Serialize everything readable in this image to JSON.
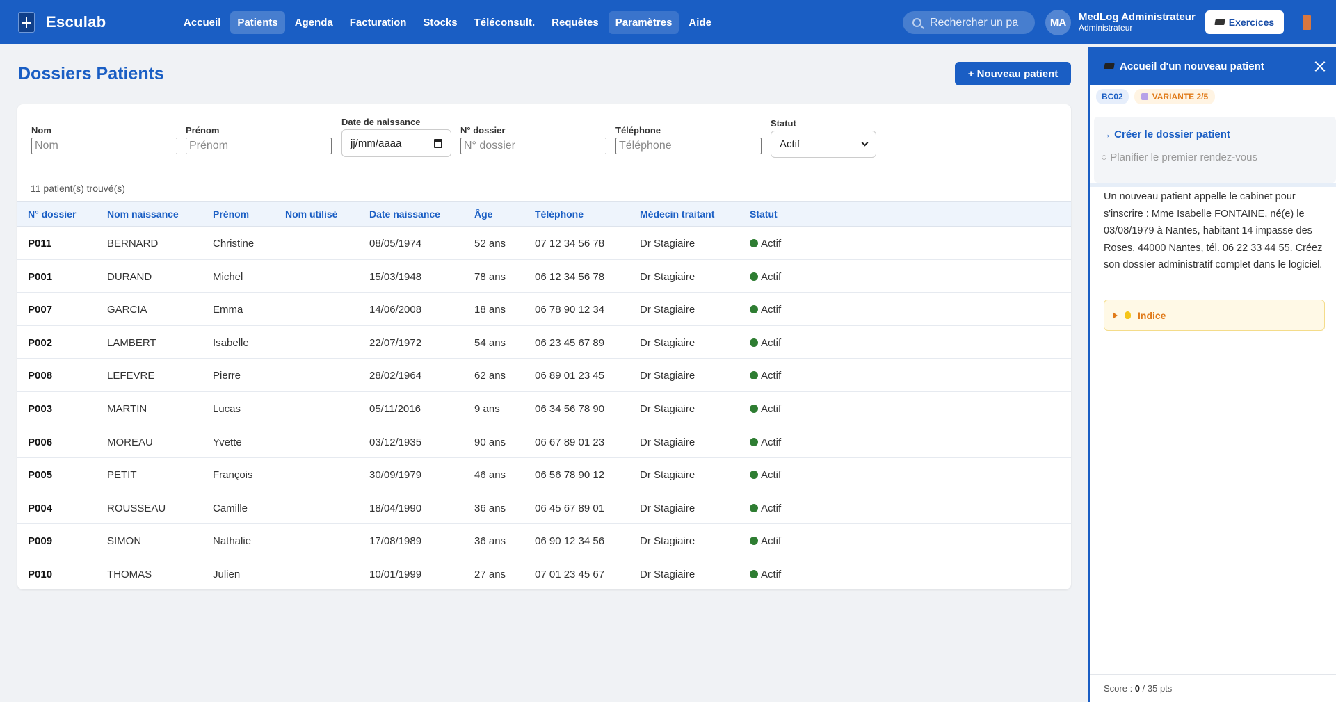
{
  "app": {
    "name": "Esculab"
  },
  "nav": [
    {
      "label": "Accueil",
      "state": ""
    },
    {
      "label": "Patients",
      "state": "active"
    },
    {
      "label": "Agenda",
      "state": ""
    },
    {
      "label": "Facturation",
      "state": ""
    },
    {
      "label": "Stocks",
      "state": ""
    },
    {
      "label": "Téléconsult.",
      "state": ""
    },
    {
      "label": "Requêtes",
      "state": ""
    },
    {
      "label": "Paramètres",
      "state": "hl"
    },
    {
      "label": "Aide",
      "state": ""
    }
  ],
  "search": {
    "placeholder": "Rechercher un pa"
  },
  "user": {
    "initials": "MA",
    "name": "MedLog Administrateur",
    "role": "Administrateur"
  },
  "exercises_label": "Exercices",
  "page": {
    "title": "Dossiers Patients",
    "new_patient_label": "+ Nouveau patient"
  },
  "filters": {
    "nom": {
      "label": "Nom",
      "placeholder": "Nom"
    },
    "prenom": {
      "label": "Prénom",
      "placeholder": "Prénom"
    },
    "naissance": {
      "label": "Date de naissance",
      "placeholder": "jj/mm/aaaa"
    },
    "dossier": {
      "label": "N° dossier",
      "placeholder": "N° dossier"
    },
    "telephone": {
      "label": "Téléphone",
      "placeholder": "Téléphone"
    },
    "statut": {
      "label": "Statut",
      "value": "Actif"
    }
  },
  "result_count": "11 patient(s) trouvé(s)",
  "table": {
    "columns": [
      "N° dossier",
      "Nom naissance",
      "Prénom",
      "Nom utilisé",
      "Date naissance",
      "Âge",
      "Téléphone",
      "Médecin traitant",
      "Statut"
    ],
    "rows": [
      {
        "id": "P011",
        "nom": "BERNARD",
        "prenom": "Christine",
        "nom_utilise": "",
        "naissance": "08/05/1974",
        "age": "52 ans",
        "tel": "07 12 34 56 78",
        "medecin": "Dr Stagiaire",
        "statut": "Actif"
      },
      {
        "id": "P001",
        "nom": "DURAND",
        "prenom": "Michel",
        "nom_utilise": "",
        "naissance": "15/03/1948",
        "age": "78 ans",
        "tel": "06 12 34 56 78",
        "medecin": "Dr Stagiaire",
        "statut": "Actif"
      },
      {
        "id": "P007",
        "nom": "GARCIA",
        "prenom": "Emma",
        "nom_utilise": "",
        "naissance": "14/06/2008",
        "age": "18 ans",
        "tel": "06 78 90 12 34",
        "medecin": "Dr Stagiaire",
        "statut": "Actif"
      },
      {
        "id": "P002",
        "nom": "LAMBERT",
        "prenom": "Isabelle",
        "nom_utilise": "",
        "naissance": "22/07/1972",
        "age": "54 ans",
        "tel": "06 23 45 67 89",
        "medecin": "Dr Stagiaire",
        "statut": "Actif"
      },
      {
        "id": "P008",
        "nom": "LEFEVRE",
        "prenom": "Pierre",
        "nom_utilise": "",
        "naissance": "28/02/1964",
        "age": "62 ans",
        "tel": "06 89 01 23 45",
        "medecin": "Dr Stagiaire",
        "statut": "Actif"
      },
      {
        "id": "P003",
        "nom": "MARTIN",
        "prenom": "Lucas",
        "nom_utilise": "",
        "naissance": "05/11/2016",
        "age": "9 ans",
        "tel": "06 34 56 78 90",
        "medecin": "Dr Stagiaire",
        "statut": "Actif"
      },
      {
        "id": "P006",
        "nom": "MOREAU",
        "prenom": "Yvette",
        "nom_utilise": "",
        "naissance": "03/12/1935",
        "age": "90 ans",
        "tel": "06 67 89 01 23",
        "medecin": "Dr Stagiaire",
        "statut": "Actif"
      },
      {
        "id": "P005",
        "nom": "PETIT",
        "prenom": "François",
        "nom_utilise": "",
        "naissance": "30/09/1979",
        "age": "46 ans",
        "tel": "06 56 78 90 12",
        "medecin": "Dr Stagiaire",
        "statut": "Actif"
      },
      {
        "id": "P004",
        "nom": "ROUSSEAU",
        "prenom": "Camille",
        "nom_utilise": "",
        "naissance": "18/04/1990",
        "age": "36 ans",
        "tel": "06 45 67 89 01",
        "medecin": "Dr Stagiaire",
        "statut": "Actif"
      },
      {
        "id": "P009",
        "nom": "SIMON",
        "prenom": "Nathalie",
        "nom_utilise": "",
        "naissance": "17/08/1989",
        "age": "36 ans",
        "tel": "06 90 12 34 56",
        "medecin": "Dr Stagiaire",
        "statut": "Actif"
      },
      {
        "id": "P010",
        "nom": "THOMAS",
        "prenom": "Julien",
        "nom_utilise": "",
        "naissance": "10/01/1999",
        "age": "27 ans",
        "tel": "07 01 23 45 67",
        "medecin": "Dr Stagiaire",
        "statut": "Actif"
      }
    ]
  },
  "panel": {
    "title": "Accueil d'un nouveau patient",
    "code": "BC02",
    "variant": "VARIANTE 2/5",
    "step_active": "→ Créer le dossier patient",
    "step_pending": "○ Planifier le premier rendez-vous",
    "task": "Un nouveau patient appelle le cabinet pour s'inscrire : Mme Isabelle FONTAINE, né(e) le 03/08/1979 à Nantes, habitant 14 impasse des Roses, 44000 Nantes, tél. 06 22 33 44 55. Créez son dossier administratif complet dans le logiciel.",
    "hint_label": "Indice",
    "score_label": "Score : ",
    "score_value": "0",
    "score_total": " / 35 pts"
  },
  "colors": {
    "primary": "#1a5ec4",
    "status_active": "#2e7d32",
    "hint": "#e07b1a"
  },
  "icons": [
    "search-icon",
    "graduation-cap-icon",
    "exit-icon",
    "close-icon",
    "dice-icon",
    "triangle-right-icon",
    "lightbulb-icon",
    "calendar-icon",
    "chevron-down-icon"
  ]
}
